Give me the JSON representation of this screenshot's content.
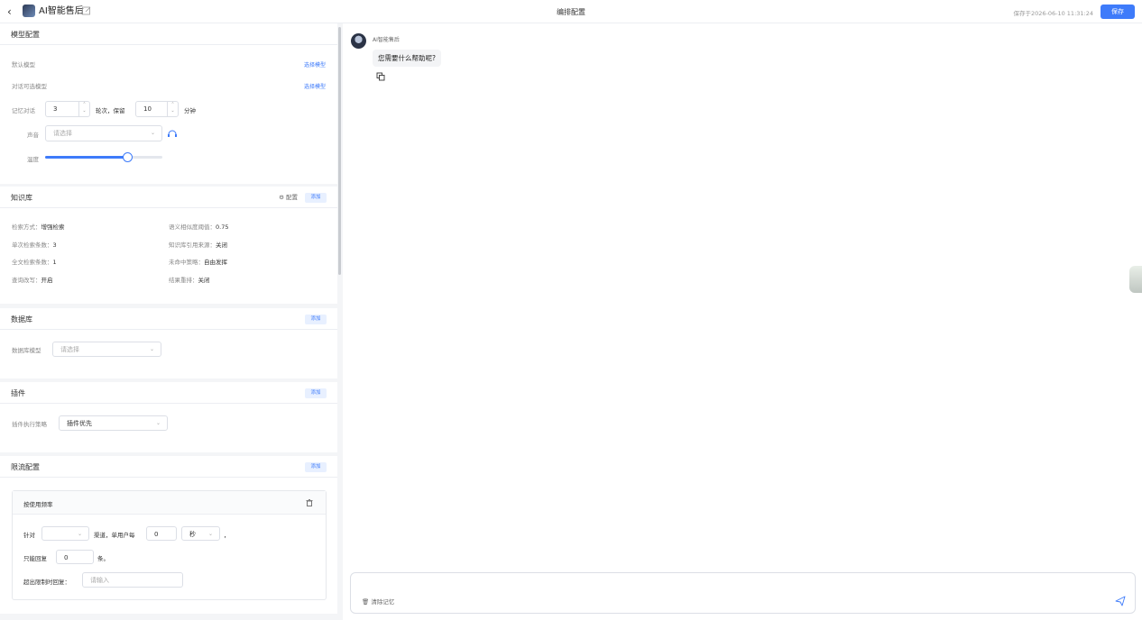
{
  "header": {
    "app_name": "AI智能售后",
    "center_title": "编排配置",
    "saved_at": "保存于2026-06-10 11:31:24",
    "save_label": "保存"
  },
  "model_config": {
    "title": "模型配置",
    "default_model_label": "默认模型",
    "default_model_link": "选择模型",
    "dialog_models_label": "对话可选模型",
    "dialog_models_link": "选择模型",
    "memory_label": "记忆对话",
    "memory_rounds": "3",
    "rounds_keep_text": "轮次，保留",
    "keep_minutes": "10",
    "minutes_text": "分钟",
    "voice_label": "声音",
    "voice_placeholder": "请选择",
    "temperature_label": "温度",
    "temperature_fraction": 0.7
  },
  "knowledge": {
    "title": "知识库",
    "config_label": "配置",
    "add_label": "添加",
    "items": [
      {
        "k": "检索方式：",
        "v": "增强检索"
      },
      {
        "k": "单次检索条数：",
        "v": "3"
      },
      {
        "k": "全文检索条数：",
        "v": "1"
      },
      {
        "k": "查询改写：",
        "v": "开启"
      },
      {
        "k": "语义相似度阈值：",
        "v": "0.75"
      },
      {
        "k": "知识库引用来源：",
        "v": "关闭"
      },
      {
        "k": "未命中策略：",
        "v": "自由发挥"
      },
      {
        "k": "结果重排：",
        "v": "关闭"
      }
    ]
  },
  "database": {
    "title": "数据库",
    "add_label": "添加",
    "model_label": "数据库模型",
    "model_placeholder": "请选择"
  },
  "plugin": {
    "title": "插件",
    "add_label": "添加",
    "strategy_label": "插件执行策略",
    "strategy_value": "插件优先"
  },
  "rate_limit": {
    "title": "限流配置",
    "add_label": "添加",
    "rule_title": "按使用频率",
    "for_label": "针对",
    "channel_text": "渠道，单用户每",
    "per_value": "0",
    "unit_value": "秒",
    "comma": "，",
    "only_reply_label": "只能回复",
    "reply_count": "0",
    "count_unit": "条。",
    "exceed_label": "超出限制时回复：",
    "exceed_placeholder": "请输入"
  },
  "chat": {
    "bot_name": "AI智能售后",
    "greeting": "您需要什么帮助呢?",
    "clear_memory_label": "清除记忆"
  }
}
